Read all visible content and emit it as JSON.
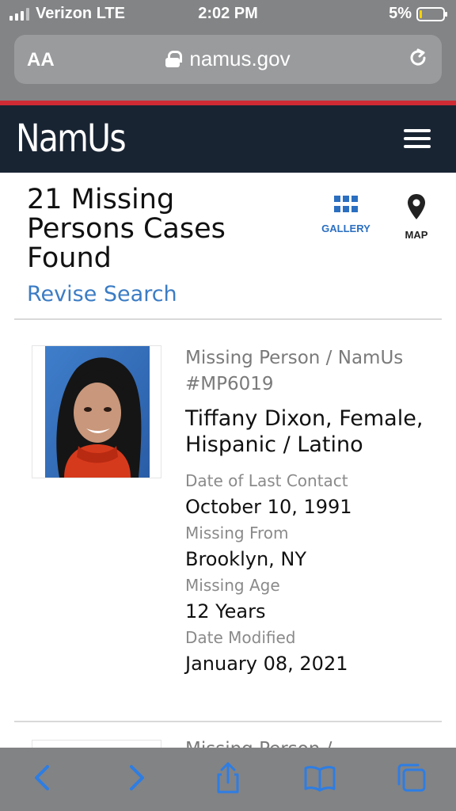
{
  "status_bar": {
    "carrier": "Verizon LTE",
    "time": "2:02 PM",
    "battery": "5%"
  },
  "safari": {
    "text_size_label": "AA",
    "url": "namus.gov"
  },
  "site": {
    "logo": "NamUs"
  },
  "results": {
    "title": "21 Missing Persons Cases Found",
    "revise_link": "Revise Search",
    "gallery_label": "GALLERY",
    "map_label": "MAP"
  },
  "case": {
    "type": "Missing Person / NamUs #MP6019",
    "name": "Tiffany Dixon, Female, Hispanic / Latino",
    "fields": [
      {
        "label": "Date of Last Contact",
        "value": "October 10, 1991"
      },
      {
        "label": "Missing From",
        "value": "Brooklyn, NY"
      },
      {
        "label": "Missing Age",
        "value": "12 Years"
      },
      {
        "label": "Date Modified",
        "value": "January 08, 2021"
      }
    ]
  },
  "next_case": {
    "type": "Missing Person /"
  },
  "colors": {
    "brand_navy": "#192433",
    "brand_red": "#cf2b35",
    "link_blue": "#3b7cc4",
    "ios_blue": "#2d7de3"
  }
}
